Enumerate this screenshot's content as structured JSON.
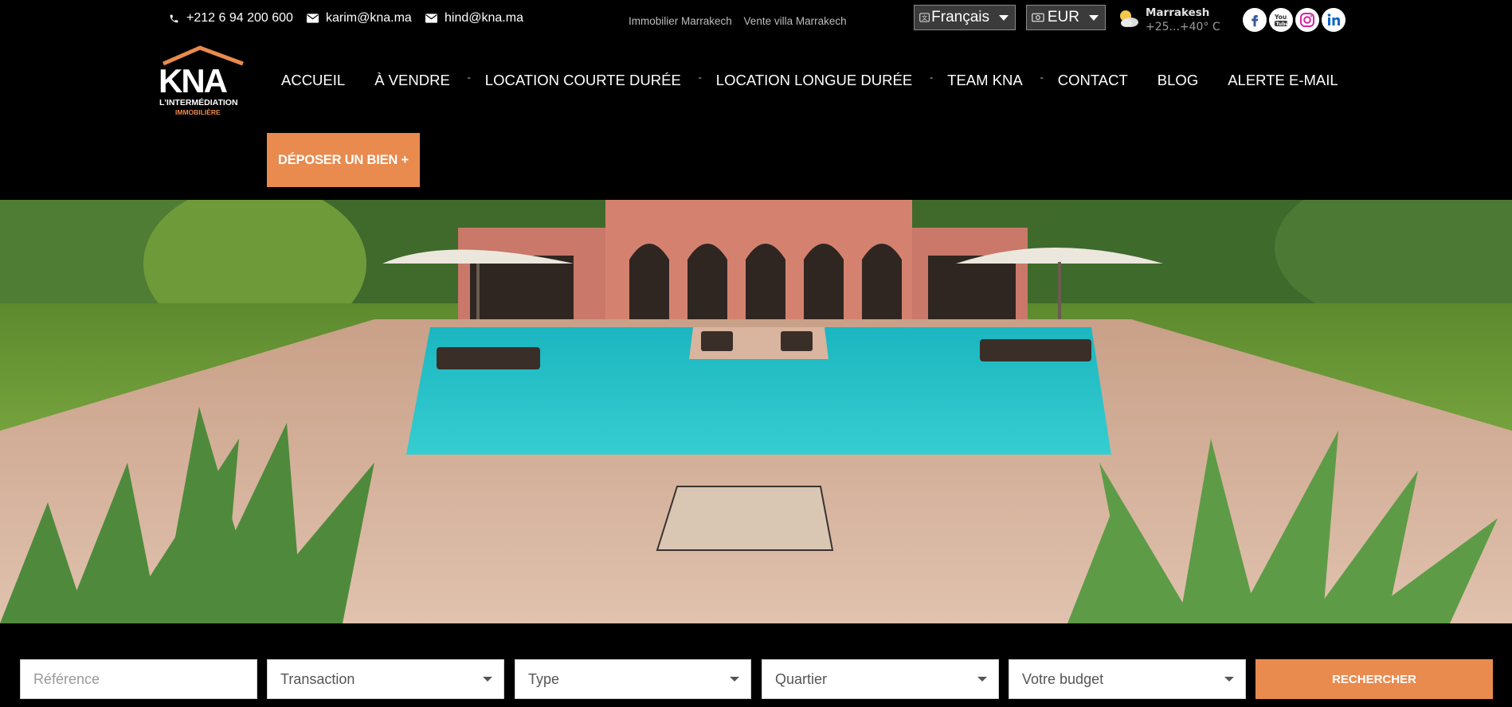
{
  "topbar": {
    "phone": "+212 6 94 200 600",
    "email1": "karim@kna.ma",
    "email2": "hind@kna.ma",
    "links": [
      "Immobilier Marrakech",
      "Vente villa Marrakech"
    ],
    "language": "Français",
    "currency": "EUR",
    "weather": {
      "city": "Marrakesh",
      "temp": "+25...+40° C"
    },
    "social": [
      "facebook-icon",
      "youtube-icon",
      "instagram-icon",
      "linkedin-icon"
    ]
  },
  "logo": {
    "name": "KNA",
    "tagline": "L'INTERMÉDIATION",
    "subtagline": "IMMOBILIÈRE"
  },
  "nav": {
    "items": [
      "ACCUEIL",
      "À VENDRE",
      "LOCATION COURTE DURÉE",
      "LOCATION LONGUE DURÉE",
      "TEAM KNA",
      "CONTACT",
      "BLOG",
      "ALERTE E-MAIL"
    ],
    "separator": "-",
    "cta": "DÉPOSER UN BIEN +"
  },
  "search": {
    "reference_placeholder": "Référence",
    "transaction": "Transaction",
    "type": "Type",
    "quartier": "Quartier",
    "budget": "Votre budget",
    "button": "RECHERCHER"
  },
  "colors": {
    "accent": "#e98a4e",
    "background": "#000000"
  }
}
